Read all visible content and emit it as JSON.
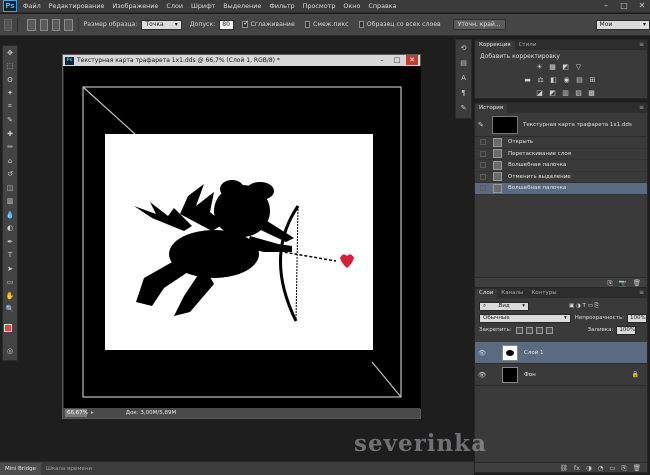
{
  "app": {
    "logo": "Ps",
    "menu": [
      "Файл",
      "Редактирование",
      "Изображение",
      "Слои",
      "Шрифт",
      "Выделение",
      "Фильтр",
      "Просмотр",
      "Окно",
      "Справка"
    ],
    "window_controls": {
      "minimize": "–",
      "maximize": "□",
      "close": "✕"
    }
  },
  "options": {
    "sample_size_label": "Размер образца:",
    "sample_size_value": "Точка",
    "tolerance_label": "Допуск:",
    "tolerance_value": "80",
    "antialias_label": "Сглаживание",
    "contiguous_label": "Смеж.пикс",
    "all_layers_label": "Образец со всех слоев",
    "refine_button": "Уточн. край...",
    "workspace_value": "Мои"
  },
  "toolbar": {
    "tools": [
      "move-tool",
      "marquee-tool",
      "lasso-tool",
      "magic-wand-tool",
      "crop-tool",
      "eyedropper-tool",
      "healing-tool",
      "brush-tool",
      "stamp-tool",
      "history-brush-tool",
      "eraser-tool",
      "gradient-tool",
      "blur-tool",
      "dodge-tool",
      "pen-tool",
      "type-tool",
      "path-select-tool",
      "shape-tool",
      "hand-tool",
      "zoom-tool"
    ],
    "glyphs": [
      "✥",
      "⬚",
      "ʘ",
      "✦",
      "⌗",
      "✎",
      "✚",
      "✏",
      "⌂",
      "↺",
      "◫",
      "▥",
      "💧",
      "◐",
      "✒",
      "T",
      "➤",
      "▭",
      "✋",
      "🔍"
    ],
    "foreground_color": "#e0443c",
    "background_color": "#ffffff"
  },
  "document": {
    "title": "Текстурная карта трафарета 1х1.dds @ 66,7% (Слой 1, RGB/8) *",
    "zoom": "66,67%",
    "doc_size": "Док: 3,00M/5,89M",
    "canvas_bg": "#000000",
    "heart_color": "#d81f3a"
  },
  "adjustments": {
    "tabs": [
      "Коррекция",
      "Стили"
    ],
    "heading": "Добавить корректировку",
    "row1": [
      "☀",
      "▦",
      "◩",
      "▽"
    ],
    "row2": [
      "▬",
      "⚖",
      "◧",
      "◉",
      "▤",
      "⊞"
    ],
    "row3": [
      "◪",
      "◩",
      "▥",
      "▨",
      "▩"
    ]
  },
  "history": {
    "tabs": [
      "История"
    ],
    "snapshot_label": "Текстурная карта трафарета 1х1.dds",
    "items": [
      "Открыть",
      "Перетаскивание слоя",
      "Волшебная палочка",
      "Отменить выделение",
      "Волшебная палочка"
    ],
    "selected_index": 4,
    "footer_icons": [
      "⎘",
      "📷",
      "🗑"
    ]
  },
  "layers": {
    "tabs": [
      "Слои",
      "Каналы",
      "Контуры"
    ],
    "filter_label": "Вид",
    "blend_mode": "Обычные",
    "opacity_label": "Непрозрачность:",
    "opacity_value": "100%",
    "lock_label": "Закрепить:",
    "fill_label": "Заливка:",
    "fill_value": "100%",
    "items": [
      {
        "name": "Слой 1",
        "selected": true,
        "locked": false
      },
      {
        "name": "Фон",
        "selected": false,
        "locked": true
      }
    ],
    "footer_icons": [
      "⛓",
      "fx",
      "◑",
      "◔",
      "▭",
      "⎘",
      "🗑"
    ]
  },
  "bottom_tabs": [
    "Mini Bridge",
    "Шкала времени"
  ],
  "watermark": "severinka"
}
